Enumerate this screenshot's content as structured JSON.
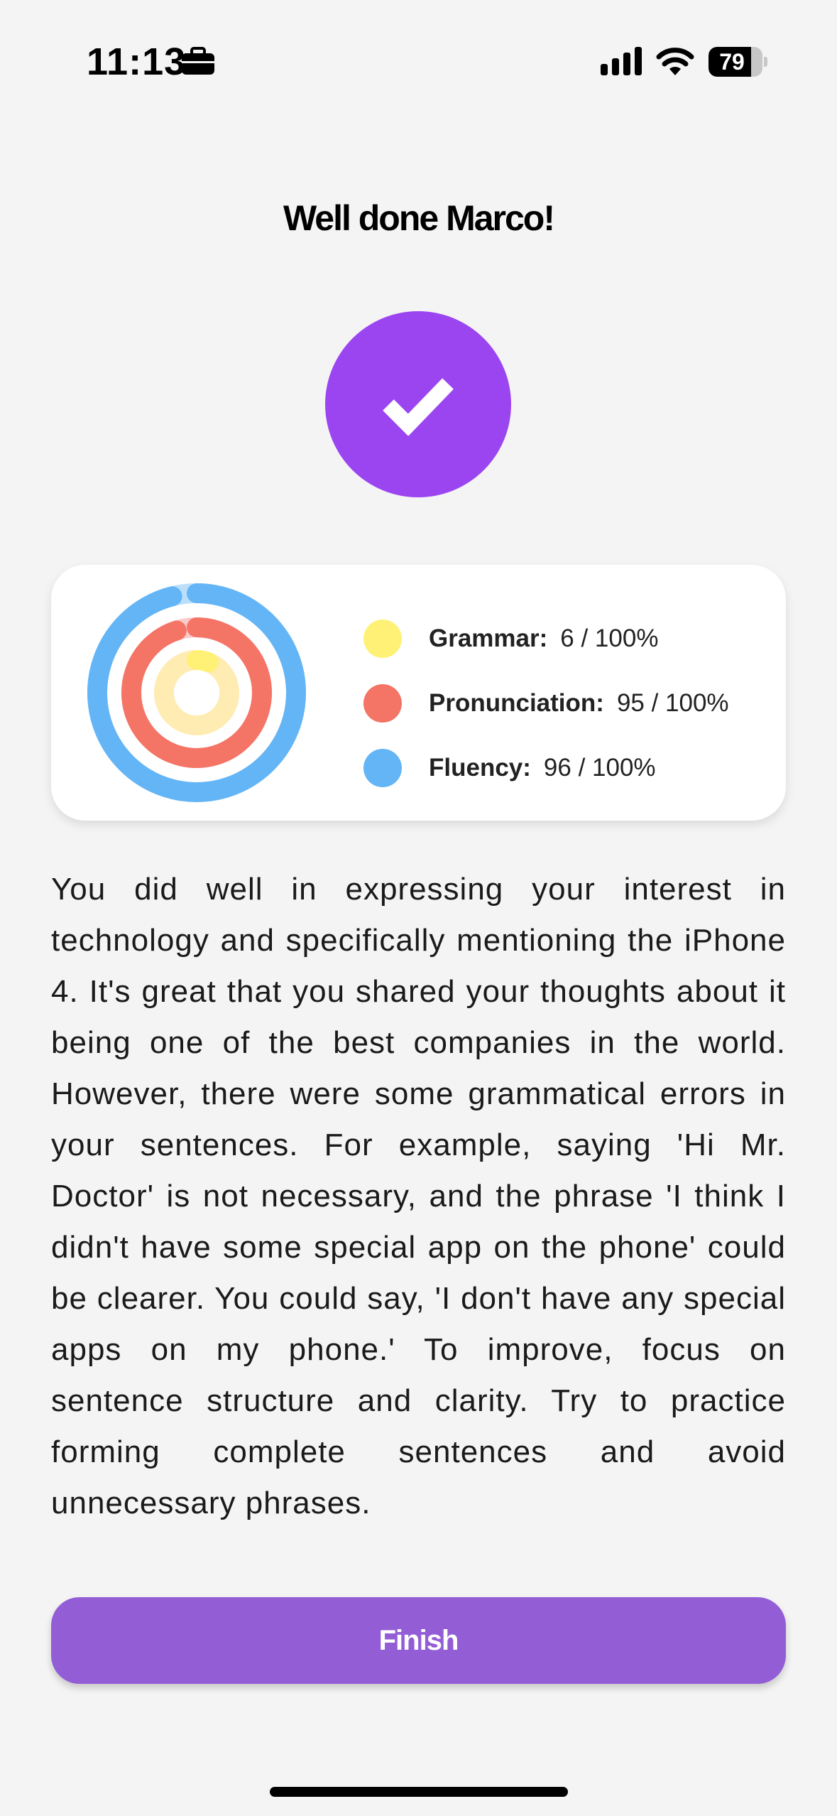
{
  "status_bar": {
    "time": "11:13",
    "battery": "79",
    "battery_level": 0.79,
    "icons": [
      "briefcase-icon",
      "signal-icon",
      "wifi-icon",
      "battery-icon"
    ]
  },
  "header": {
    "title": "Well done Marco!",
    "check_icon": "checkmark-icon",
    "check_color": "#9b45f0"
  },
  "scores": {
    "items": [
      {
        "label": "Grammar:",
        "value": "6 / 100%",
        "percent": 6,
        "color": "#fff176",
        "track": "#ffecb3"
      },
      {
        "label": "Pronunciation:",
        "value": "95 / 100%",
        "percent": 95,
        "color": "#f47466",
        "track": "#fbcaca"
      },
      {
        "label": "Fluency:",
        "value": "96 / 100%",
        "percent": 96,
        "color": "#64b5f6",
        "track": "#bbdefb"
      }
    ]
  },
  "feedback": {
    "text": "You did well in expressing your interest in technology and specifically mentioning the iPhone 4. It's great that you shared your thoughts about it being one of the best companies in the world. However, there were some grammatical errors in your sentences. For example, saying 'Hi Mr. Doctor' is not necessary, and the phrase 'I think I didn't have some special app on the phone' could be clearer. You could say, 'I don't have any special apps on my phone.' To improve, focus on sentence structure and clarity. Try to practice forming complete sentences and avoid unnecessary phrases."
  },
  "actions": {
    "finish_label": "Finish",
    "finish_color": "#935dd6"
  }
}
